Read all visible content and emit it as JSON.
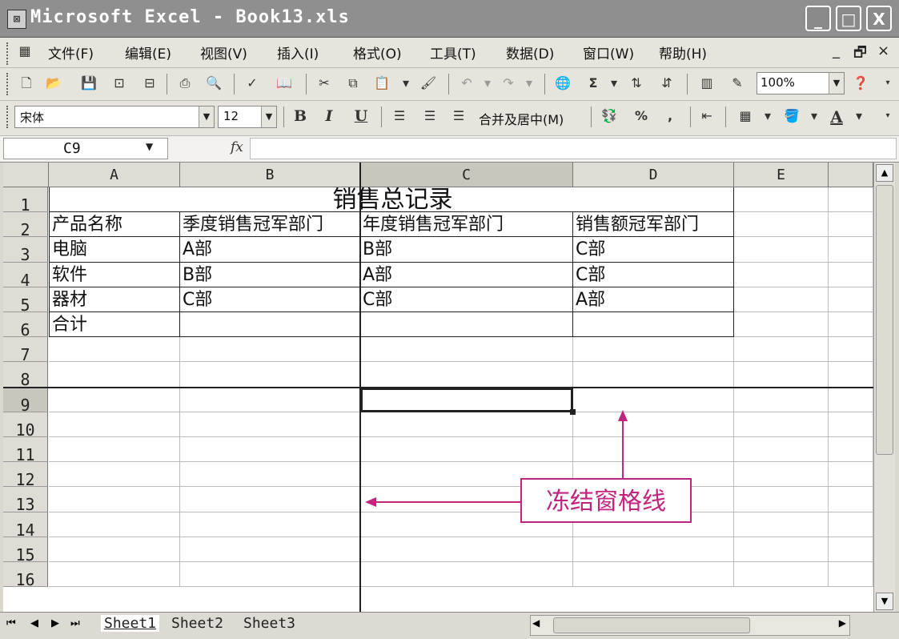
{
  "window": {
    "app_icon": "excel-app-icon",
    "title": "Microsoft Excel - Book13.xls",
    "controls": [
      "_",
      "□",
      "X"
    ]
  },
  "menubar": {
    "items": [
      "文件(F)",
      "编辑(E)",
      "视图(V)",
      "插入(I)",
      "格式(O)",
      "工具(T)",
      "数据(D)",
      "窗口(W)",
      "帮助(H)"
    ],
    "doc_controls": [
      "_",
      "🗗",
      "×"
    ]
  },
  "standard_toolbar": {
    "icons": [
      "new-icon",
      "open-icon",
      "save-icon",
      "permission-icon",
      "print-preview-icon",
      "print-icon",
      "preview-icon",
      "spelling-icon",
      "research-icon",
      "cut-icon",
      "copy-icon",
      "paste-icon",
      "format-painter-icon",
      "undo-icon",
      "redo-icon",
      "hyperlink-icon",
      "autosum-icon",
      "sort-ascending-icon",
      "sort-descending-icon",
      "chart-wizard-icon",
      "drawing-icon",
      "help-icon"
    ],
    "zoom": "100%"
  },
  "format_toolbar": {
    "font": "宋体",
    "size": "12",
    "bold": "B",
    "italic": "I",
    "underline": "U",
    "merge_label": "合并及居中(M)",
    "percent": "%",
    "comma": ","
  },
  "formula_bar": {
    "name_box": "C9",
    "fx": "fx",
    "formula": ""
  },
  "sheet": {
    "columns": [
      "A",
      "B",
      "C",
      "D",
      "E"
    ],
    "rows": [
      "1",
      "2",
      "3",
      "4",
      "5",
      "6",
      "7",
      "8",
      "9",
      "10",
      "11",
      "12",
      "13",
      "14",
      "15",
      "16"
    ],
    "title": "销售总记录",
    "header": [
      "产品名称",
      "季度销售冠军部门",
      "年度销售冠军部门",
      "销售额冠军部门"
    ],
    "data": [
      [
        "电脑",
        "A部",
        "B部",
        "C部"
      ],
      [
        "软件",
        "B部",
        "A部",
        "C部"
      ],
      [
        "器材",
        "C部",
        "C部",
        "A部"
      ],
      [
        "合计",
        "",
        "",
        ""
      ]
    ],
    "active_cell": "C9"
  },
  "sheet_tabs": [
    "Sheet1",
    "Sheet2",
    "Sheet3"
  ],
  "annotation": {
    "label": "冻结窗格线",
    "color": "#c2247f"
  }
}
